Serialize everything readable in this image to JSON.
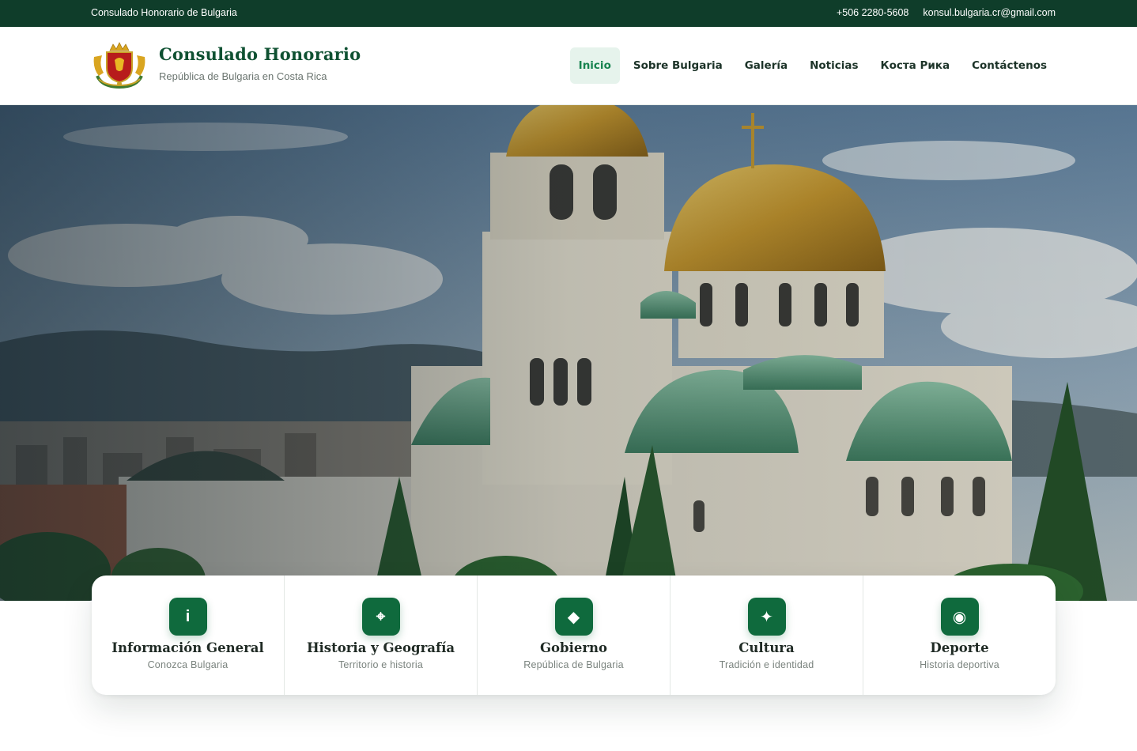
{
  "topbar": {
    "left_text": "Consulado Honorario de Bulgaria",
    "phone": "+506 2280-5608",
    "email": "konsul.bulgaria.cr@gmail.com"
  },
  "header": {
    "brand_title": "Consulado Honorario",
    "brand_subtitle": "República de Bulgaria en Costa Rica",
    "nav": [
      {
        "label": "Inicio",
        "active": true
      },
      {
        "label": "Sobre Bulgaria",
        "active": false
      },
      {
        "label": "Galería",
        "active": false
      },
      {
        "label": "Noticias",
        "active": false
      },
      {
        "label": "Коста Рика",
        "active": false
      },
      {
        "label": "Contáctenos",
        "active": false
      }
    ]
  },
  "cards": [
    {
      "icon": "info-icon",
      "glyph": "i",
      "title": "Información General",
      "subtitle": "Conozca Bulgaria"
    },
    {
      "icon": "compass-icon",
      "glyph": "⌖",
      "title": "Historia y Geografía",
      "subtitle": "Territorio e historia"
    },
    {
      "icon": "diamond-icon",
      "glyph": "◆",
      "title": "Gobierno",
      "subtitle": "República de Bulgaria"
    },
    {
      "icon": "sparkle-icon",
      "glyph": "✦",
      "title": "Cultura",
      "subtitle": "Tradición e identidad"
    },
    {
      "icon": "target-icon",
      "glyph": "◉",
      "title": "Deporte",
      "subtitle": "Historia deportiva"
    }
  ],
  "colors": {
    "topbar": "#0f3d2a",
    "brand_green": "#0f5132",
    "accent": "#17834f",
    "icon_bg": "#0f6a3d"
  }
}
